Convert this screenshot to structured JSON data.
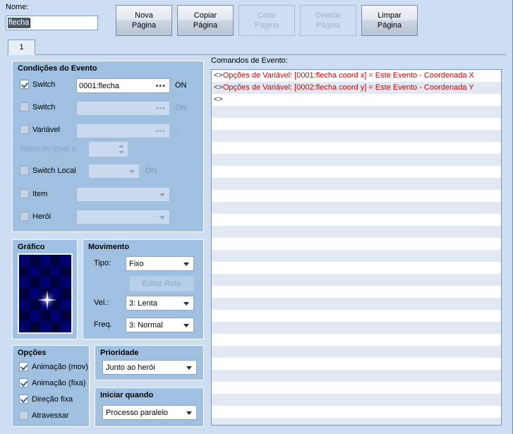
{
  "header": {
    "nome_label": "Nome:",
    "nome_value": "flecha",
    "buttons": [
      {
        "line1": "Nova",
        "line2": "Página",
        "enabled": true
      },
      {
        "line1": "Copiar",
        "line2": "Página",
        "enabled": true
      },
      {
        "line1": "Colar",
        "line2": "Página",
        "enabled": false
      },
      {
        "line1": "Deletar",
        "line2": "Página",
        "enabled": false
      },
      {
        "line1": "Limpar",
        "line2": "Página",
        "enabled": true
      }
    ]
  },
  "tabs": [
    {
      "label": "1",
      "active": true
    }
  ],
  "conditions": {
    "title": "Condições do Evento",
    "switch1": {
      "label": "Switch",
      "checked": true,
      "value": "0001:flecha",
      "state": "ON"
    },
    "switch2": {
      "label": "Switch",
      "checked": false,
      "value": "",
      "state": "ON"
    },
    "variable": {
      "label": "Variável",
      "checked": false,
      "value": "",
      "state": "-"
    },
    "greater_label": "Maior ou igual a:",
    "greater_value": "",
    "local_switch": {
      "label": "Switch Local",
      "checked": false,
      "value": "",
      "state": "ON"
    },
    "item": {
      "label": "Item",
      "checked": false,
      "value": ""
    },
    "hero": {
      "label": "Herói",
      "checked": false,
      "value": ""
    }
  },
  "graphic": {
    "title": "Gráfico"
  },
  "movement": {
    "title": "Movimento",
    "tipo_label": "Tipo:",
    "tipo_value": "Fixo",
    "edit_route_label": "Editar Rota",
    "vel_label": "Vel.:",
    "vel_value": "3: Lenta",
    "freq_label": "Freq.",
    "freq_value": "3: Normal"
  },
  "options": {
    "title": "Opções",
    "items": [
      {
        "label": "Animação (mov)",
        "checked": true
      },
      {
        "label": "Animação (fixa)",
        "checked": true
      },
      {
        "label": "Direção fixa",
        "checked": true
      },
      {
        "label": "Atravessar",
        "checked": false
      }
    ]
  },
  "priority": {
    "title": "Prioridade",
    "value": "Junto ao herói"
  },
  "trigger": {
    "title": "Iniciar quando",
    "value": "Processo paralelo"
  },
  "commands": {
    "label": "Comandos de Evento:",
    "rows": [
      {
        "bracket": "<>",
        "text": "Opções de Variável: [0001:flecha coord x] = Este Evento - Coordenada X"
      },
      {
        "bracket": "<>",
        "text": "Opções de Variável: [0002:flecha coord y] = Este Evento - Coordenada Y"
      },
      {
        "bracket": "<>",
        "text": ""
      }
    ],
    "empty_rows": 27
  },
  "colors": {
    "page_bg": "#cedef2",
    "group_bg": "#9fc0e0",
    "command_text": "#cc0000",
    "alt_row": "#e3e9f2"
  }
}
